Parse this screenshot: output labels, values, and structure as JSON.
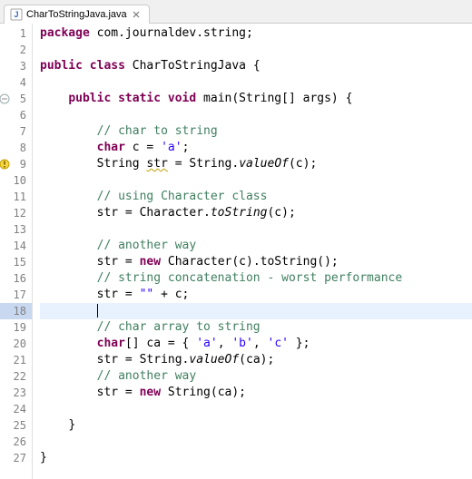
{
  "tab": {
    "label": "CharToStringJava.java",
    "iconLetter": "J"
  },
  "gutter": {
    "count": 27,
    "markers": {
      "5": "fold",
      "9": "warning"
    }
  },
  "code": {
    "l1_pkg": "package",
    "l1_rest": " com.journaldev.string;",
    "l3_pub": "public",
    "l3_cls": " class",
    "l3_name": " CharToStringJava {",
    "l5_ind": "    ",
    "l5_pub": "public",
    "l5_stat": " static",
    "l5_void": " void",
    "l5_rest": " main(String[] args) {",
    "l7_ind": "        ",
    "l7_cm": "// char to string",
    "l8_ind": "        ",
    "l8_char": "char",
    "l8_mid": " c = ",
    "l8_lit": "'a'",
    "l8_end": ";",
    "l9_ind": "        ",
    "l9_a": "String ",
    "l9_var": "str",
    "l9_b": " = String.",
    "l9_m": "valueOf",
    "l9_c": "(c);",
    "l11_ind": "        ",
    "l11_cm": "// using Character class",
    "l12_ind": "        ",
    "l12_a": "str = Character.",
    "l12_m": "toString",
    "l12_b": "(c);",
    "l14_ind": "        ",
    "l14_cm": "// another way",
    "l15_ind": "        ",
    "l15_a": "str = ",
    "l15_new": "new",
    "l15_b": " Character(c).toString();",
    "l16_ind": "        ",
    "l16_cm": "// string concatenation - worst performance",
    "l17_ind": "        ",
    "l17_a": "str = ",
    "l17_s": "\"\"",
    "l17_b": " + c;",
    "l18_ind": "        ",
    "l19_ind": "        ",
    "l19_cm": "// char array to string",
    "l20_ind": "        ",
    "l20_char": "char",
    "l20_a": "[] ca = { ",
    "l20_s1": "'a'",
    "l20_c1": ", ",
    "l20_s2": "'b'",
    "l20_c2": ", ",
    "l20_s3": "'c'",
    "l20_b": " };",
    "l21_ind": "        ",
    "l21_a": "str = String.",
    "l21_m": "valueOf",
    "l21_b": "(ca);",
    "l22_ind": "        ",
    "l22_cm": "// another way",
    "l23_ind": "        ",
    "l23_a": "str = ",
    "l23_new": "new",
    "l23_b": " String(ca);",
    "l25_ind": "    ",
    "l25_br": "}",
    "l27_br": "}"
  }
}
